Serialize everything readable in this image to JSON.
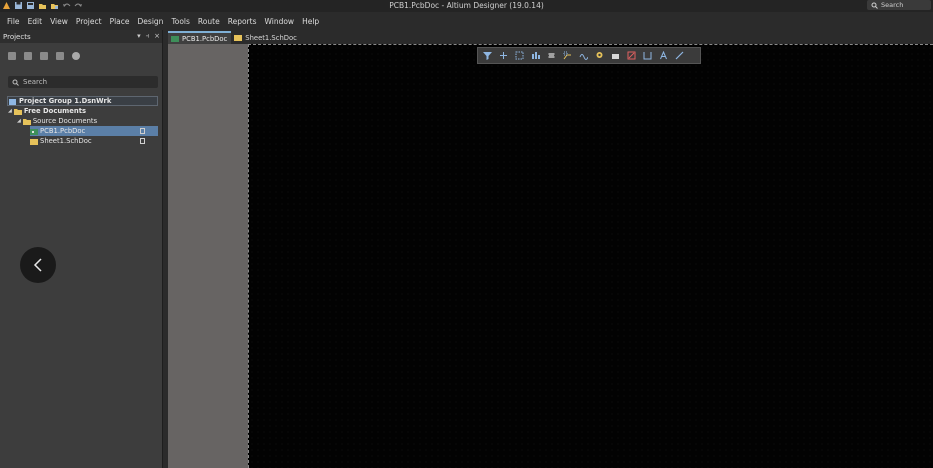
{
  "window": {
    "title": "PCB1.PcbDoc - Altium Designer (19.0.14)",
    "search_label": "Search"
  },
  "menu": [
    "File",
    "Edit",
    "View",
    "Project",
    "Place",
    "Design",
    "Tools",
    "Route",
    "Reports",
    "Window",
    "Help"
  ],
  "panel": {
    "title": "Projects",
    "search_placeholder": "Search",
    "tree": {
      "group": "Project Group 1.DsnWrk",
      "free_documents": "Free Documents",
      "source_documents": "Source Documents",
      "docs": [
        "PCB1.PcbDoc",
        "Sheet1.SchDoc"
      ],
      "selected_doc": "PCB1.PcbDoc"
    }
  },
  "tabs": [
    "PCB1.PcbDoc",
    "Sheet1.SchDoc"
  ],
  "active_tab": "PCB1.PcbDoc",
  "toolbar_icons": [
    "filter-icon",
    "add-icon",
    "select-rect-icon",
    "align-icon",
    "component-icon",
    "route-icon",
    "interactive-route-icon",
    "via-icon",
    "fill-icon",
    "region-icon",
    "dimension-icon",
    "text-icon",
    "line-icon"
  ],
  "colors": {
    "accent": "#7fb0d6",
    "selection": "#5b7fa7",
    "canvas": "#020202"
  }
}
